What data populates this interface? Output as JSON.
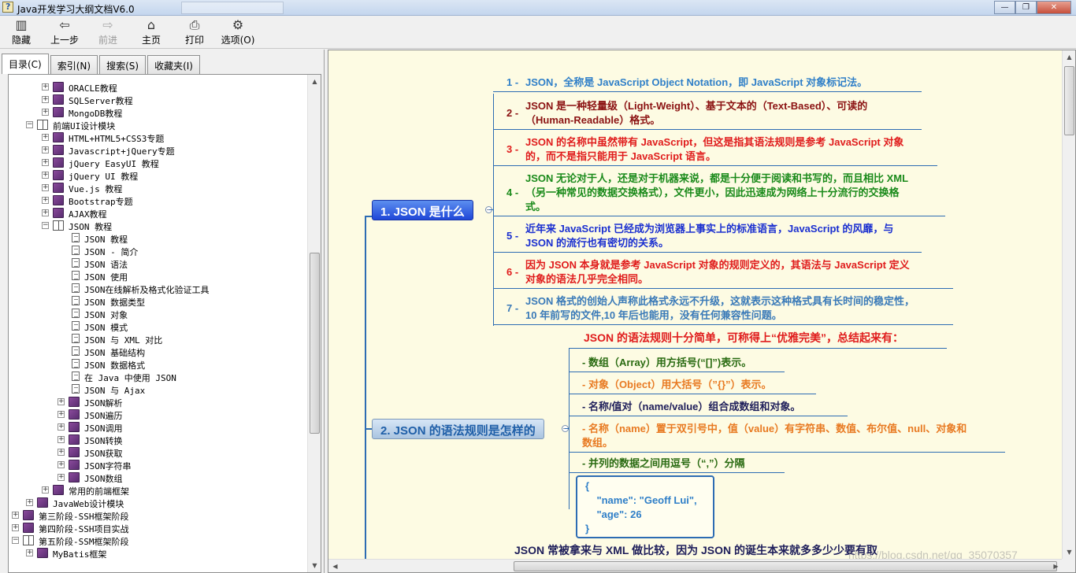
{
  "window": {
    "title": "Java开发学习大纲文档V6.0",
    "min": "0",
    "max": "1",
    "close": "r"
  },
  "toolbar": {
    "items": [
      {
        "label": "隐藏",
        "icon": "hide-pane-icon"
      },
      {
        "label": "上一步",
        "icon": "back-arrow-icon"
      },
      {
        "label": "前进",
        "icon": "forward-arrow-icon"
      },
      {
        "label": "主页",
        "icon": "home-icon"
      },
      {
        "label": "打印",
        "icon": "printer-icon"
      },
      {
        "label": "选项(O)",
        "icon": "options-icon"
      }
    ]
  },
  "tabs": [
    "目录(C)",
    "索引(N)",
    "搜索(S)",
    "收藏夹(I)"
  ],
  "tree": [
    {
      "label": "ORACLE教程",
      "level": 2,
      "expander": "+",
      "icon": "book"
    },
    {
      "label": "SQLServer教程",
      "level": 2,
      "expander": "+",
      "icon": "book"
    },
    {
      "label": "MongoDB教程",
      "level": 2,
      "expander": "+",
      "icon": "book"
    },
    {
      "label": "前端UI设计模块",
      "level": 1,
      "expander": "−",
      "icon": "open"
    },
    {
      "label": "HTML+HTML5+CSS3专题",
      "level": 2,
      "expander": "+",
      "icon": "book"
    },
    {
      "label": "Javascript+jQuery专题",
      "level": 2,
      "expander": "+",
      "icon": "book"
    },
    {
      "label": "jQuery EasyUI 教程",
      "level": 2,
      "expander": "+",
      "icon": "book"
    },
    {
      "label": "jQuery UI 教程",
      "level": 2,
      "expander": "+",
      "icon": "book"
    },
    {
      "label": "Vue.js 教程",
      "level": 2,
      "expander": "+",
      "icon": "book"
    },
    {
      "label": "Bootstrap专题",
      "level": 2,
      "expander": "+",
      "icon": "book"
    },
    {
      "label": "AJAX教程",
      "level": 2,
      "expander": "+",
      "icon": "book"
    },
    {
      "label": "JSON 教程",
      "level": 2,
      "expander": "−",
      "icon": "open"
    },
    {
      "label": "JSON 教程",
      "level": 3,
      "expander": "",
      "icon": "page"
    },
    {
      "label": "JSON - 简介",
      "level": 3,
      "expander": "",
      "icon": "page"
    },
    {
      "label": "JSON 语法",
      "level": 3,
      "expander": "",
      "icon": "page"
    },
    {
      "label": "JSON 使用",
      "level": 3,
      "expander": "",
      "icon": "page"
    },
    {
      "label": "JSON在线解析及格式化验证工具",
      "level": 3,
      "expander": "",
      "icon": "page"
    },
    {
      "label": "JSON 数据类型",
      "level": 3,
      "expander": "",
      "icon": "page"
    },
    {
      "label": "JSON 对象",
      "level": 3,
      "expander": "",
      "icon": "page"
    },
    {
      "label": "JSON 模式",
      "level": 3,
      "expander": "",
      "icon": "page"
    },
    {
      "label": "JSON 与 XML 对比",
      "level": 3,
      "expander": "",
      "icon": "page"
    },
    {
      "label": "JSON 基础结构",
      "level": 3,
      "expander": "",
      "icon": "page"
    },
    {
      "label": "JSON 数据格式",
      "level": 3,
      "expander": "",
      "icon": "page"
    },
    {
      "label": "在 Java 中使用 JSON",
      "level": 3,
      "expander": "",
      "icon": "page"
    },
    {
      "label": "JSON 与 Ajax",
      "level": 3,
      "expander": "",
      "icon": "page"
    },
    {
      "label": "JSON解析",
      "level": 3,
      "expander": "+",
      "icon": "book"
    },
    {
      "label": "JSON遍历",
      "level": 3,
      "expander": "+",
      "icon": "book"
    },
    {
      "label": "JSON调用",
      "level": 3,
      "expander": "+",
      "icon": "book"
    },
    {
      "label": "JSON转换",
      "level": 3,
      "expander": "+",
      "icon": "book"
    },
    {
      "label": "JSON获取",
      "level": 3,
      "expander": "+",
      "icon": "book"
    },
    {
      "label": "JSON字符串",
      "level": 3,
      "expander": "+",
      "icon": "book"
    },
    {
      "label": "JSON数组",
      "level": 3,
      "expander": "+",
      "icon": "book"
    },
    {
      "label": "常用的前端框架",
      "level": 2,
      "expander": "+",
      "icon": "book"
    },
    {
      "label": "JavaWeb设计模块",
      "level": 1,
      "expander": "+",
      "icon": "book"
    },
    {
      "label": "第三阶段-SSH框架阶段",
      "level": 0,
      "expander": "+",
      "icon": "book"
    },
    {
      "label": "第四阶段-SSH项目实战",
      "level": 0,
      "expander": "+",
      "icon": "book"
    },
    {
      "label": "第五阶段-SSM框架阶段",
      "level": 0,
      "expander": "−",
      "icon": "open"
    },
    {
      "label": "MyBatis框架",
      "level": 1,
      "expander": "+",
      "icon": "book"
    }
  ],
  "mindmap": {
    "node1": "1. JSON 是什么",
    "node2": "2. JSON 的语法规则是怎样的",
    "items1": [
      {
        "num": "1 -",
        "lines": [
          "JSON，全称是 JavaScript Object Notation，即 JavaScript 对象标记法。"
        ],
        "color": "c-blue"
      },
      {
        "num": "2 -",
        "lines": [
          "JSON 是一种轻量级（Light-Weight）、基于文本的（Text-Based）、可读的",
          "（Human-Readable）格式。"
        ],
        "color": "c-darkred"
      },
      {
        "num": "3 -",
        "lines": [
          "JSON 的名称中虽然带有 JavaScript，但这是指其语法规则是参考 JavaScript 对象",
          "的，而不是指只能用于 JavaScript 语言。"
        ],
        "color": "c-red"
      },
      {
        "num": "4 -",
        "lines": [
          "JSON 无论对于人，还是对于机器来说，都是十分便于阅读和书写的，而且相比 XML",
          "（另一种常见的数据交换格式），文件更小，因此迅速成为网络上十分流行的交换格",
          "式。"
        ],
        "color": "c-green"
      },
      {
        "num": "5 -",
        "lines": [
          "近年来 JavaScript 已经成为浏览器上事实上的标准语言，JavaScript 的风靡，与",
          "JSON 的流行也有密切的关系。"
        ],
        "color": "c-navy"
      },
      {
        "num": "6 -",
        "lines": [
          "因为 JSON 本身就是参考 JavaScript 对象的规则定义的，其语法与 JavaScript 定义",
          "对象的语法几乎完全相同。"
        ],
        "color": "c-red"
      },
      {
        "num": "7 -",
        "lines": [
          "JSON 格式的创始人声称此格式永远不升级，这就表示这种格式具有长时间的稳定性，",
          "10 年前写的文件,10 年后也能用，没有任何兼容性问题。"
        ],
        "color": "c-steel"
      }
    ],
    "rules_intro": "JSON 的语法规则十分简单，可称得上“优雅完美”，总结起来有：",
    "rules": [
      {
        "lines": [
          "- 数组（Array）用方括号(“[]”)表示。"
        ],
        "color": "c-darkgreen"
      },
      {
        "lines": [
          "- 对象（Object）用大括号（”{}”）表示。"
        ],
        "color": "c-orange"
      },
      {
        "lines": [
          "- 名称/值对（name/value）组合成数组和对象。"
        ],
        "color": "c-dark"
      },
      {
        "lines": [
          "- 名称（name）置于双引号中，值（value）有字符串、数值、布尔值、null、对象和",
          "数组。"
        ],
        "color": "c-orange"
      },
      {
        "lines": [
          "- 并列的数据之间用逗号（“,”）分隔"
        ],
        "color": "c-darkgreen"
      }
    ],
    "code": "{\n    \"name\": \"Geoff Lui\",\n    \"age\": 26\n}",
    "bottom_text": "JSON 常被拿来与 XML 做比较，因为 JSON 的诞生本来就多多少少要有取",
    "watermark": "https://blog.csdn.net/qq_35070357"
  }
}
